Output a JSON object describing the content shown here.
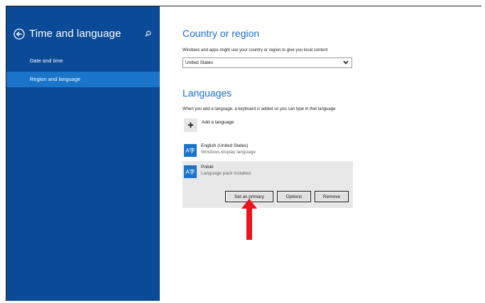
{
  "sidebar": {
    "title": "Time and language",
    "back_icon": "back-arrow-circle-icon",
    "search_icon": "search-icon",
    "items": [
      {
        "label": "Date and time",
        "selected": false
      },
      {
        "label": "Region and language",
        "selected": true
      }
    ],
    "background": "#0a4a96",
    "selected_background": "#1a74c9"
  },
  "country": {
    "heading": "Country or region",
    "description": "Windows and apps might use your country or region to give you local content",
    "selected_value": "United States"
  },
  "languages": {
    "heading": "Languages",
    "description": "When you add a language, a keyboard is added so you can type in that language",
    "add_label": "Add a language",
    "list": [
      {
        "name": "English (United States)",
        "status": "Windows display language",
        "icon": "language-icon"
      },
      {
        "name": "Polski",
        "status": "Language pack installed",
        "icon": "language-icon"
      }
    ],
    "buttons": {
      "set_primary": "Set as primary",
      "options": "Options",
      "remove": "Remove"
    }
  },
  "colors": {
    "accent": "#1a6fcc",
    "annotation_arrow": "#e8141e"
  }
}
